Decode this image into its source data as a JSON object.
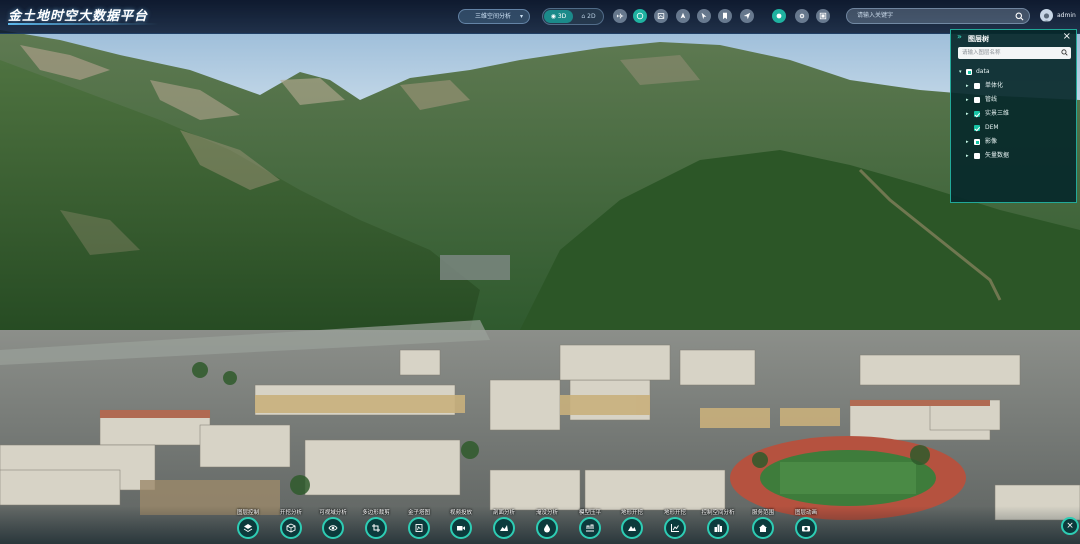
{
  "app": {
    "title": "金土地时空大数据平台"
  },
  "header": {
    "analysis_select": "三维空间分析",
    "mode_3d": "3D",
    "mode_2d": "2D",
    "search_placeholder": "请输入关键字",
    "username": "admin",
    "tools": [
      {
        "icon": "airplane-icon"
      },
      {
        "icon": "globe-icon",
        "active": true
      },
      {
        "icon": "image-icon"
      },
      {
        "icon": "pin-icon"
      },
      {
        "icon": "cursor-icon"
      },
      {
        "icon": "bookmark-icon"
      },
      {
        "icon": "send-icon"
      },
      {
        "icon": "layers-icon",
        "active": true
      },
      {
        "icon": "settings-icon"
      },
      {
        "icon": "window-icon"
      }
    ]
  },
  "layer_panel": {
    "title": "图层树",
    "search_placeholder": "请输入图层名称",
    "items": [
      {
        "label": "data",
        "state": "partial",
        "level": 0
      },
      {
        "label": "单体化",
        "state": "unchecked",
        "level": 1
      },
      {
        "label": "管线",
        "state": "unchecked",
        "level": 1
      },
      {
        "label": "实景三维",
        "state": "checked",
        "level": 1
      },
      {
        "label": "DEM",
        "state": "checked",
        "level": 1
      },
      {
        "label": "影像",
        "state": "partial",
        "level": 1
      },
      {
        "label": "矢量数据",
        "state": "unchecked",
        "level": 1
      }
    ]
  },
  "bottom_tools": [
    {
      "label": "图层控制",
      "icon": "layers-icon"
    },
    {
      "label": "开挖分析",
      "icon": "cube-icon"
    },
    {
      "label": "可视域分析",
      "icon": "eye-icon"
    },
    {
      "label": "多边形裁剪",
      "icon": "crop-icon"
    },
    {
      "label": "金子塔图",
      "icon": "pyramid-icon"
    },
    {
      "label": "视频投放",
      "icon": "video-icon"
    },
    {
      "label": "剖面分析",
      "icon": "profile-icon"
    },
    {
      "label": "淹没分析",
      "icon": "flood-icon"
    },
    {
      "label": "模型压平",
      "icon": "flatten-icon"
    },
    {
      "label": "地形开挖",
      "icon": "terrain-icon"
    },
    {
      "label": "地形开挖",
      "icon": "chart-icon"
    },
    {
      "label": "控制空间分析",
      "icon": "building-icon"
    },
    {
      "label": "服务范围",
      "icon": "home-icon"
    },
    {
      "label": "图层动画",
      "icon": "camera-icon"
    }
  ],
  "colors": {
    "accent": "#2ecdb4",
    "panel_bg": "#06282a",
    "topbar_bg": "#0a1830"
  }
}
